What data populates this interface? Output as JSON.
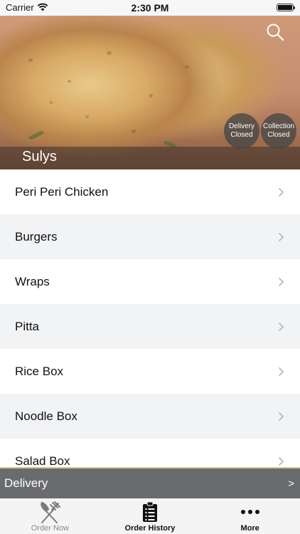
{
  "status_bar": {
    "carrier": "Carrier",
    "time": "2:30 PM",
    "battery_level": 1.0
  },
  "hero": {
    "restaurant_name": "Sulys",
    "delivery_status": {
      "line1": "Delivery",
      "line2": "Closed"
    },
    "collection_status": {
      "line1": "Collection",
      "line2": "Closed"
    }
  },
  "categories": [
    {
      "label": "Peri Peri Chicken"
    },
    {
      "label": "Burgers"
    },
    {
      "label": "Wraps"
    },
    {
      "label": "Pitta"
    },
    {
      "label": "Rice Box"
    },
    {
      "label": "Noodle Box"
    },
    {
      "label": "Salad Box"
    }
  ],
  "delivery_bar": {
    "label": "Delivery",
    "arrow": ">"
  },
  "tab_bar": {
    "tabs": [
      {
        "label": "Order Now",
        "icon": "fork-knife-icon"
      },
      {
        "label": "Order History",
        "icon": "clipboard-list-icon"
      },
      {
        "label": "More",
        "icon": "more-dots-icon"
      }
    ]
  },
  "colors": {
    "delivery_bar_bg": "#6a6b6d",
    "delivery_bar_border": "#d9c38a",
    "row_alt_bg": "#f2f3f5",
    "tab_bar_bg": "#f4f4f4"
  }
}
